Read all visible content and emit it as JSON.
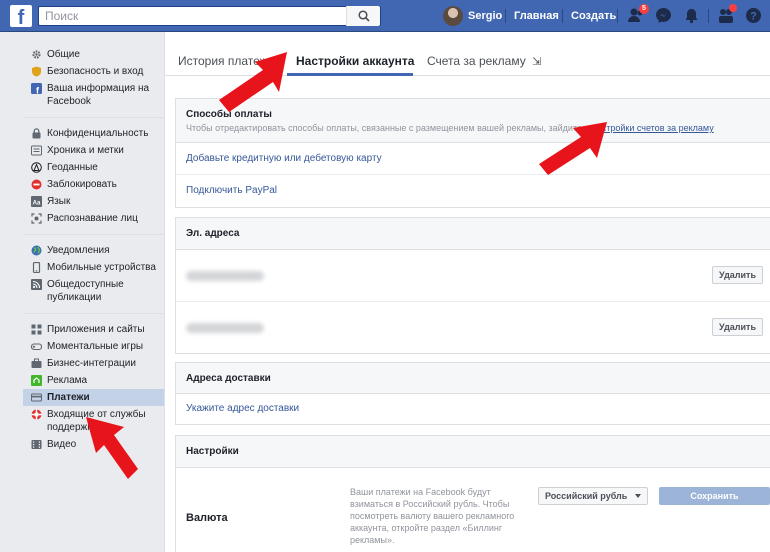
{
  "topbar": {
    "logo": "f",
    "search_placeholder": "Поиск",
    "user_name": "Sergio",
    "nav_home": "Главная",
    "nav_create": "Создать",
    "friend_requests_badge": "5",
    "brand_color": "#4267b2"
  },
  "sidebar": {
    "groups": [
      {
        "items": [
          {
            "label": "Общие",
            "icon": "gear-icon"
          },
          {
            "label": "Безопасность и вход",
            "icon": "shield-icon"
          },
          {
            "label": "Ваша информация на Facebook",
            "icon": "facebook-icon"
          }
        ]
      },
      {
        "items": [
          {
            "label": "Конфиденциальность",
            "icon": "lock-icon"
          },
          {
            "label": "Хроника и метки",
            "icon": "timeline-icon"
          },
          {
            "label": "Геоданные",
            "icon": "location-icon"
          },
          {
            "label": "Заблокировать",
            "icon": "block-icon"
          },
          {
            "label": "Язык",
            "icon": "language-icon"
          },
          {
            "label": "Распознавание лиц",
            "icon": "face-recognition-icon"
          }
        ]
      },
      {
        "items": [
          {
            "label": "Уведомления",
            "icon": "globe-icon"
          },
          {
            "label": "Мобильные устройства",
            "icon": "mobile-icon"
          },
          {
            "label": "Общедоступные публикации",
            "icon": "rss-icon"
          }
        ]
      },
      {
        "items": [
          {
            "label": "Приложения и сайты",
            "icon": "apps-icon"
          },
          {
            "label": "Моментальные игры",
            "icon": "gamepad-icon"
          },
          {
            "label": "Бизнес-интеграции",
            "icon": "business-icon"
          },
          {
            "label": "Реклама",
            "icon": "ads-icon"
          },
          {
            "label": "Платежи",
            "icon": "payment-card-icon",
            "active": true
          },
          {
            "label": "Входящие от службы поддержки",
            "icon": "support-icon"
          },
          {
            "label": "Видео",
            "icon": "video-icon"
          }
        ]
      }
    ]
  },
  "tabs": {
    "history": "История платежей",
    "settings": "Настройки аккаунта",
    "ads_accounts": "Счета за рекламу",
    "ads_accounts_icon": "⇲"
  },
  "payment_methods": {
    "title": "Способы оплаты",
    "subtitle_prefix": "Чтобы отредактировать способы оплаты, связанные с размещением вашей рекламы, зайдите в ",
    "subtitle_link": "настройки счетов за рекламу",
    "add_card": "Добавьте кредитную или дебетовую карту",
    "add_paypal": "Подключить PayPal"
  },
  "emails": {
    "title": "Эл. адреса",
    "delete_label": "Удалить"
  },
  "shipping": {
    "title": "Адреса доставки",
    "add_address": "Укажите адрес доставки"
  },
  "settings": {
    "title": "Настройки",
    "currency_label": "Валюта",
    "currency_desc": "Ваши платежи на Facebook будут взиматься в Российский рубль. Чтобы посмотреть валюту вашего рекламного аккаунта, откройте раздел «Биллинг рекламы».",
    "currency_value": "Российский рубль",
    "save_label": "Сохранить изменения"
  }
}
